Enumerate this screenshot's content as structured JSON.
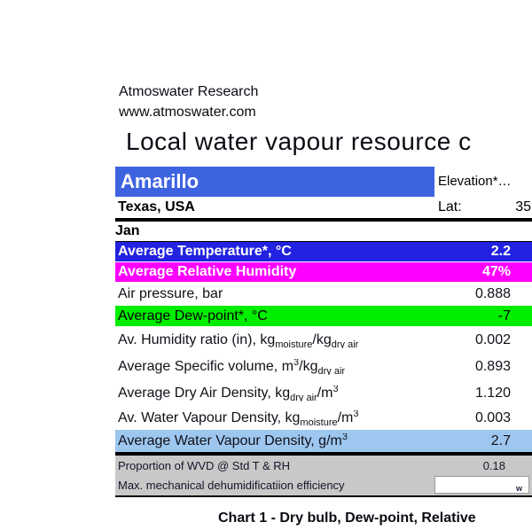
{
  "header": {
    "org": "Atmoswater Research",
    "url": "www.atmoswater.com",
    "title": "Local water vapour resource c"
  },
  "location": {
    "city": "Amarillo",
    "region": "Texas, USA",
    "elevation_label": "Elevation*…",
    "lat_label": "Lat:",
    "lat_value": "35"
  },
  "table": {
    "month_header": "Jan",
    "rows": [
      {
        "name": "avg-temperature",
        "style": "blue",
        "value": "2.2",
        "segments": [
          {
            "t": "Average Temperature*, °C"
          }
        ]
      },
      {
        "name": "avg-relative-humidity",
        "style": "magenta",
        "value": "47%",
        "segments": [
          {
            "t": "Average Relative Humidity"
          }
        ]
      },
      {
        "name": "air-pressure",
        "style": "plain",
        "value": "0.888",
        "segments": [
          {
            "t": "Air pressure, bar"
          }
        ]
      },
      {
        "name": "avg-dew-point",
        "style": "green",
        "value": "-7",
        "segments": [
          {
            "t": "Average Dew-point*, °C"
          }
        ]
      },
      {
        "name": "humidity-ratio",
        "style": "plain-tall",
        "value": "0.002",
        "segments": [
          {
            "t": "Av. Humidity ratio (in), kg"
          },
          {
            "t": "moisture",
            "pos": "sub"
          },
          {
            "t": "/kg"
          },
          {
            "t": "dry air",
            "pos": "sub"
          }
        ]
      },
      {
        "name": "specific-volume",
        "style": "plain-tall",
        "value": "0.893",
        "segments": [
          {
            "t": "Average Specific volume, m"
          },
          {
            "t": "3",
            "pos": "sup"
          },
          {
            "t": "/kg"
          },
          {
            "t": "dry air",
            "pos": "sub"
          }
        ]
      },
      {
        "name": "dry-air-density",
        "style": "plain-tall",
        "value": "1.120",
        "segments": [
          {
            "t": "Average Dry Air Density, kg"
          },
          {
            "t": "dry air",
            "pos": "sub"
          },
          {
            "t": "/m"
          },
          {
            "t": "3",
            "pos": "sup"
          }
        ]
      },
      {
        "name": "water-vapour-density-kg",
        "style": "plain",
        "value": "0.003",
        "segments": [
          {
            "t": "Av. Water Vapour Density, kg"
          },
          {
            "t": "moisture",
            "pos": "sub"
          },
          {
            "t": "/m"
          },
          {
            "t": "3",
            "pos": "sup"
          }
        ]
      },
      {
        "name": "avg-water-vapour-density",
        "style": "lightblue",
        "value": "2.7",
        "segments": [
          {
            "t": "Average Water Vapour Density, g/m"
          },
          {
            "t": "3",
            "pos": "sup"
          }
        ]
      }
    ],
    "footer_rows": [
      {
        "name": "wvd-proportion",
        "label": "Proportion of WVD @ Std T & RH",
        "value": "0.18"
      },
      {
        "name": "dehumidification-efficiency",
        "label": "Max. mechanical dehumidificatiion efficiency",
        "value": "",
        "marker": "w"
      }
    ]
  },
  "chart_caption": "Chart 1 - Dry bulb, Dew-point, Relative",
  "colors": {
    "city_cell_blue": "#3e63e0",
    "temperature_row_blue": "#2222e0",
    "humidity_row_magenta": "#ff00ff",
    "dew_point_row_green": "#00ee00",
    "wvd_row_lightblue": "#9ec7f0",
    "footer_gray": "#c8c8c8"
  }
}
